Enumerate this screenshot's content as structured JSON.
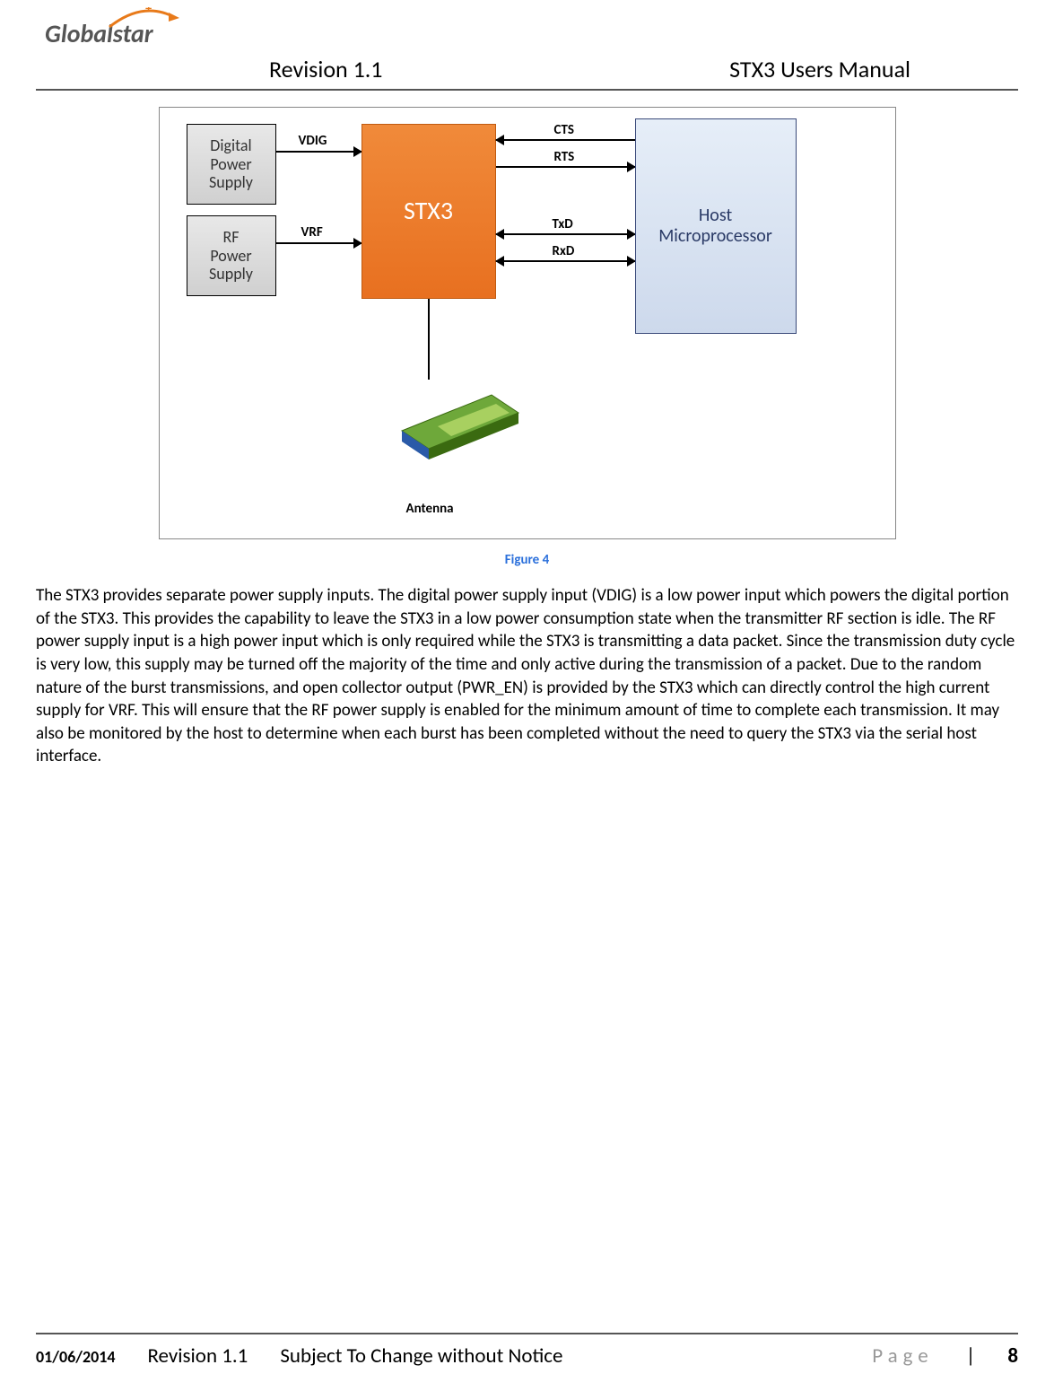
{
  "logo": "Globalstar",
  "header": {
    "revision": "Revision 1.1",
    "title": "STX3 Users Manual"
  },
  "diagram": {
    "digital_supply": "Digital\nPower\nSupply",
    "rf_supply": "RF\nPower\nSupply",
    "stx3": "STX3",
    "host": "Host\nMicroprocessor",
    "vdig": "VDIG",
    "vrf": "VRF",
    "cts": "CTS",
    "rts": "RTS",
    "txd": "TxD",
    "rxd": "RxD",
    "antenna": "Antenna"
  },
  "caption": "Figure 4",
  "body": "The STX3 provides separate power supply inputs.  The digital power supply input (VDIG) is a low power input which powers the digital portion of the STX3.  This provides the capability to leave the STX3 in a low power consumption state when the transmitter RF section is idle.  The RF power supply input is a high power input which is only required while the STX3 is transmitting a data packet.  Since the transmission duty cycle is very low, this supply may be turned off the majority of the time and only active during the transmission of a packet.  Due to the random nature of the burst transmissions, and open collector output (PWR_EN) is provided by the STX3 which can directly control the high current supply for VRF.  This will ensure that the RF power supply is enabled for the minimum amount of time to complete each transmission.  It may also be monitored by the host to determine when each burst has been completed without the need to query the STX3 via the serial host interface.",
  "footer": {
    "date": "01/06/2014",
    "revision": "Revision 1.1",
    "notice": "Subject To Change without Notice",
    "page_label": "Page",
    "page_sep": " | ",
    "page_num": "8"
  }
}
